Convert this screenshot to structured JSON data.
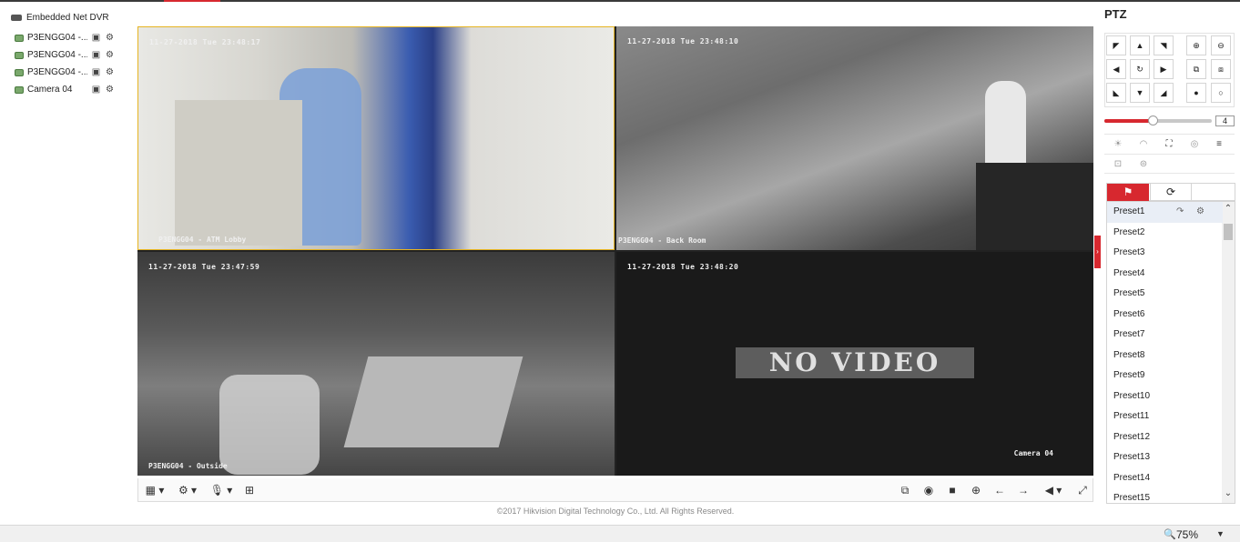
{
  "device_tree": {
    "root_label": "Embedded Net DVR",
    "cameras": [
      {
        "label": "P3ENGG04 -..."
      },
      {
        "label": "P3ENGG04 -..."
      },
      {
        "label": "P3ENGG04 -..."
      },
      {
        "label": "Camera 04"
      }
    ]
  },
  "video": {
    "tiles": [
      {
        "timestamp": "11-27-2018 Tue 23:48:17",
        "name": "P3ENGG04 - ATM Lobby"
      },
      {
        "timestamp": "11-27-2018 Tue 23:48:10",
        "name": "P3ENGG04 - Back Room"
      },
      {
        "timestamp": "11-27-2018 Tue 23:47:59",
        "name": "P3ENGG04 - Outside"
      },
      {
        "timestamp": "11-27-2018 Tue 23:48:20",
        "name": "Camera 04",
        "no_video": "NO VIDEO"
      }
    ]
  },
  "toolbar": {
    "left": [
      "window-layout-icon",
      "stream-type-icon",
      "microphone-icon",
      "playback-icon"
    ],
    "right": [
      "stop-all-icon",
      "capture-icon",
      "record-icon",
      "digital-zoom-icon",
      "previous-page-icon",
      "next-page-icon",
      "volume-icon",
      "fullscreen-icon"
    ]
  },
  "copyright": "©2017 Hikvision Digital Technology Co., Ltd. All Rights Reserved.",
  "ptz": {
    "title": "PTZ",
    "speed_value": "4",
    "speed_fraction": 0.45,
    "presets": [
      "Preset1",
      "Preset2",
      "Preset3",
      "Preset4",
      "Preset5",
      "Preset6",
      "Preset7",
      "Preset8",
      "Preset9",
      "Preset10",
      "Preset11",
      "Preset12",
      "Preset13",
      "Preset14",
      "Preset15"
    ]
  },
  "status": {
    "zoom": "75%"
  },
  "colors": {
    "accent": "#d7282f",
    "selected_tile_border": "#e6b422"
  }
}
